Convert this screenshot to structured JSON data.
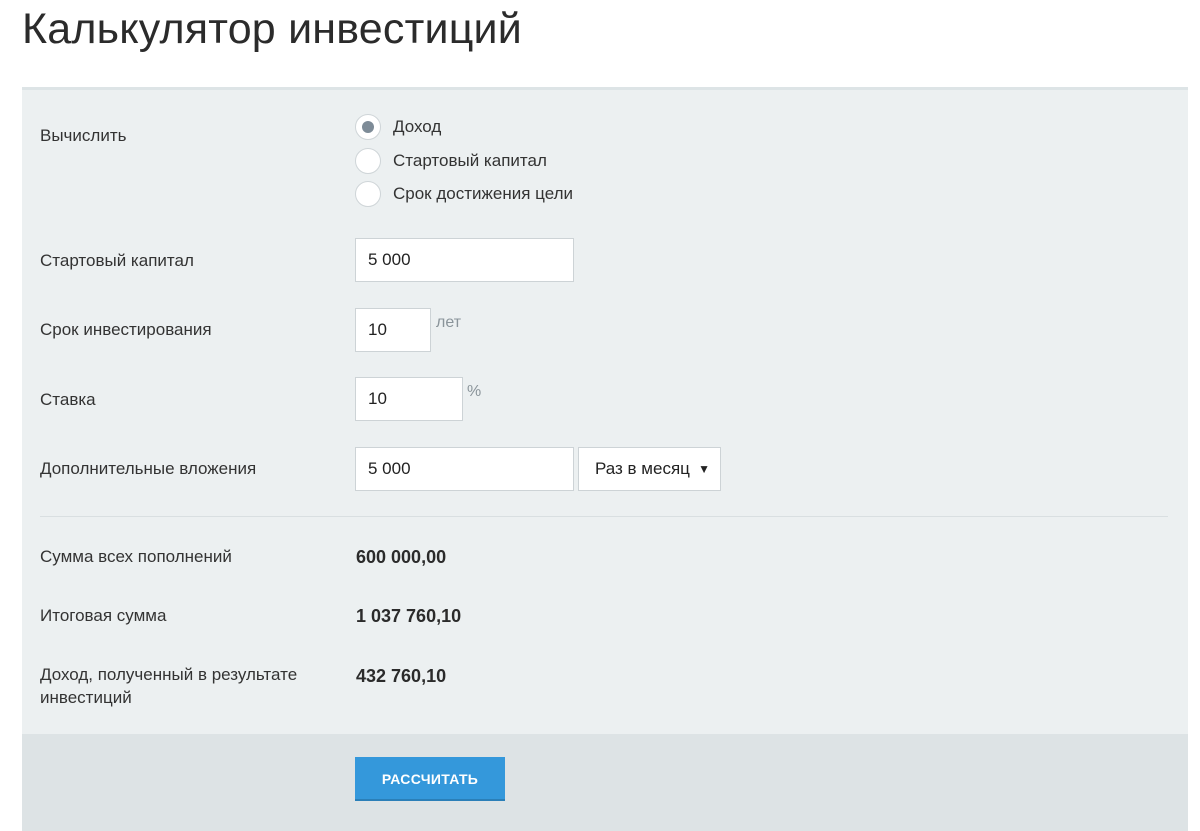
{
  "title": "Калькулятор инвестиций",
  "compute": {
    "label": "Вычислить",
    "options": [
      {
        "label": "Доход",
        "checked": true
      },
      {
        "label": "Стартовый капитал",
        "checked": false
      },
      {
        "label": "Срок достижения цели",
        "checked": false
      }
    ]
  },
  "start_capital": {
    "label": "Стартовый капитал",
    "value": "5 000"
  },
  "term": {
    "label": "Срок инвестирования",
    "value": "10",
    "unit": "лет"
  },
  "rate": {
    "label": "Ставка",
    "value": "10",
    "unit": "%"
  },
  "additional": {
    "label": "Дополнительные вложения",
    "value": "5 000",
    "frequency": "Раз в месяц"
  },
  "results": {
    "total_deposits": {
      "label": "Сумма всех пополнений",
      "value": "600 000,00"
    },
    "final_sum": {
      "label": "Итоговая сумма",
      "value": "1 037 760,10"
    },
    "income": {
      "label": "Доход, полученный в результате инвестиций",
      "value": "432 760,10"
    }
  },
  "calculate_label": "РАССЧИТАТЬ",
  "colors": {
    "accent": "#3498db",
    "panel": "#ecf0f1",
    "footer": "#dde3e5"
  }
}
